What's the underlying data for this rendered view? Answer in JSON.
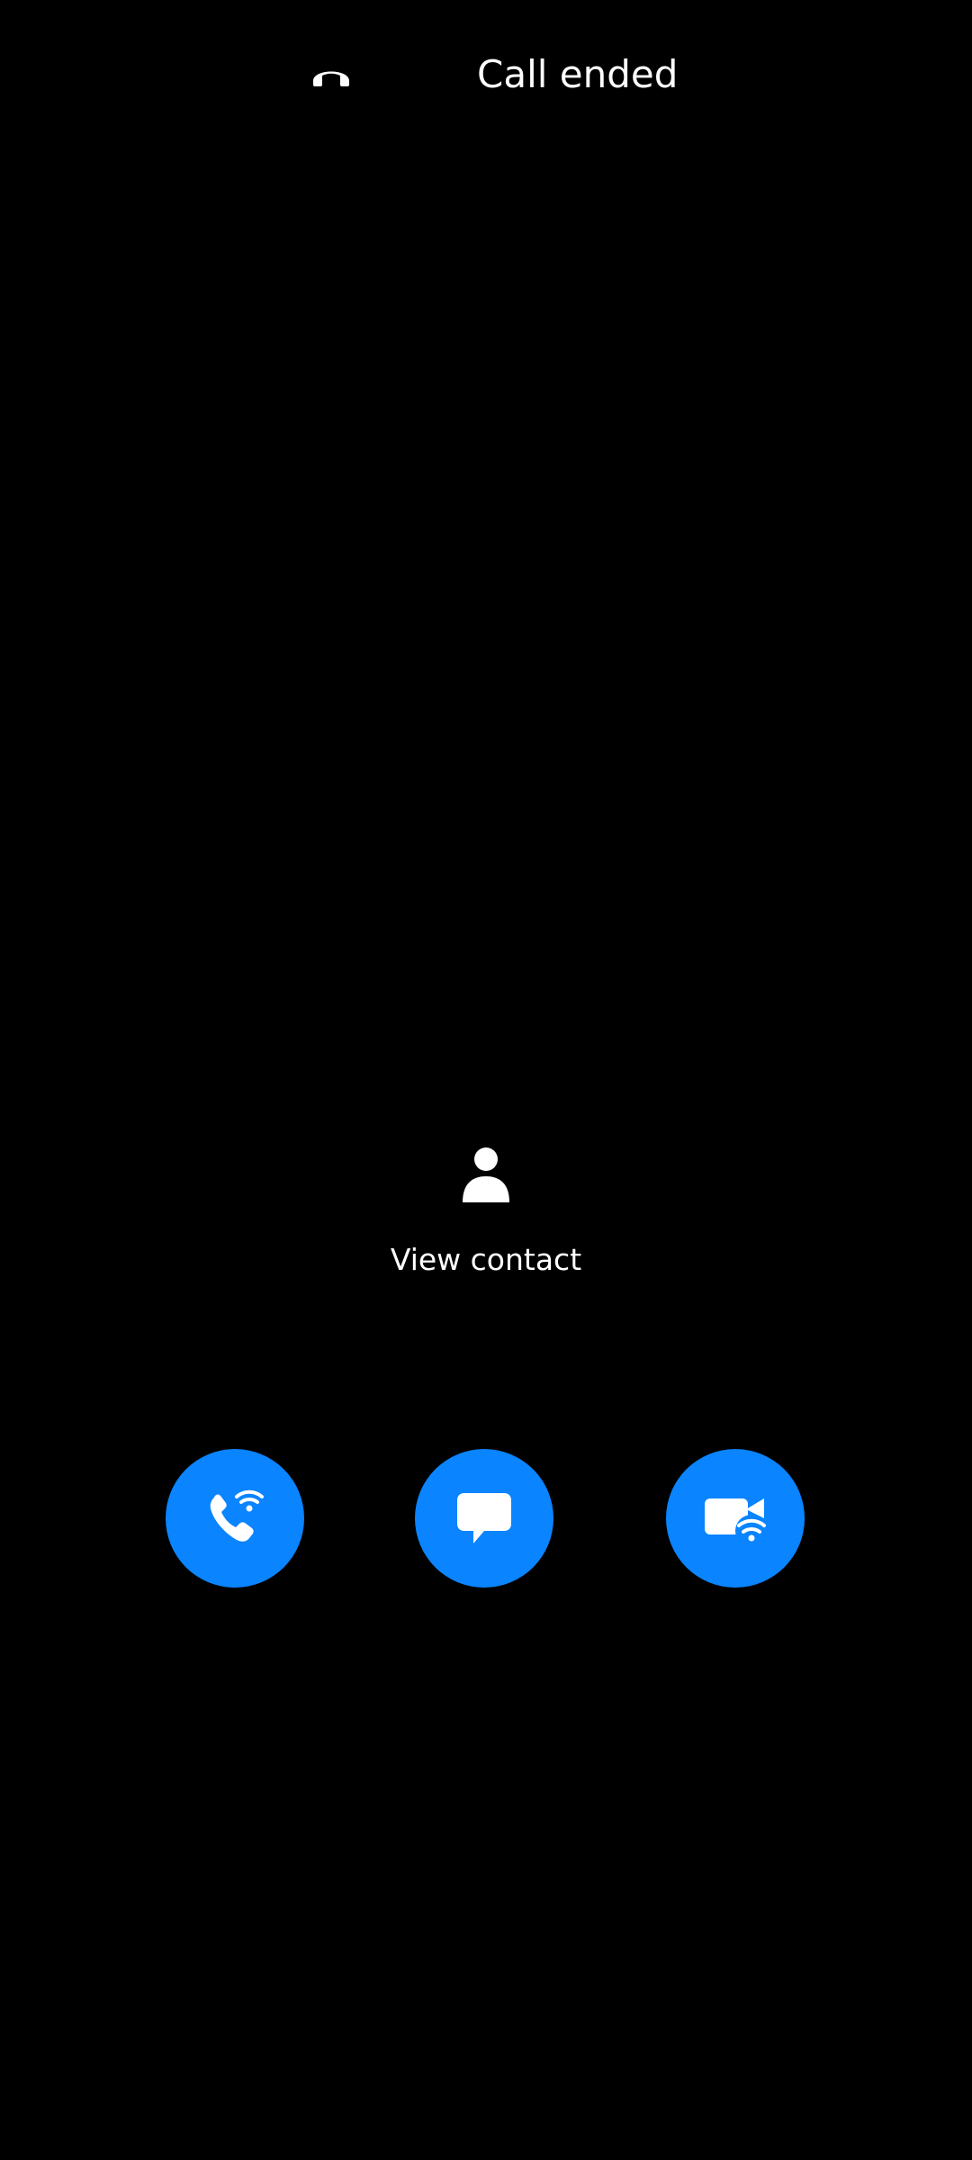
{
  "header": {
    "status_icon": "call-end-icon",
    "status_text": "Call ended"
  },
  "contact": {
    "icon": "person-icon",
    "label": "View contact"
  },
  "actions": [
    {
      "name": "wifi-call-button",
      "icon": "wifi-call-icon"
    },
    {
      "name": "message-button",
      "icon": "message-icon"
    },
    {
      "name": "wifi-video-call-button",
      "icon": "wifi-video-call-icon"
    }
  ],
  "colors": {
    "background": "#000000",
    "accent": "#0a84ff",
    "text": "#ffffff"
  }
}
